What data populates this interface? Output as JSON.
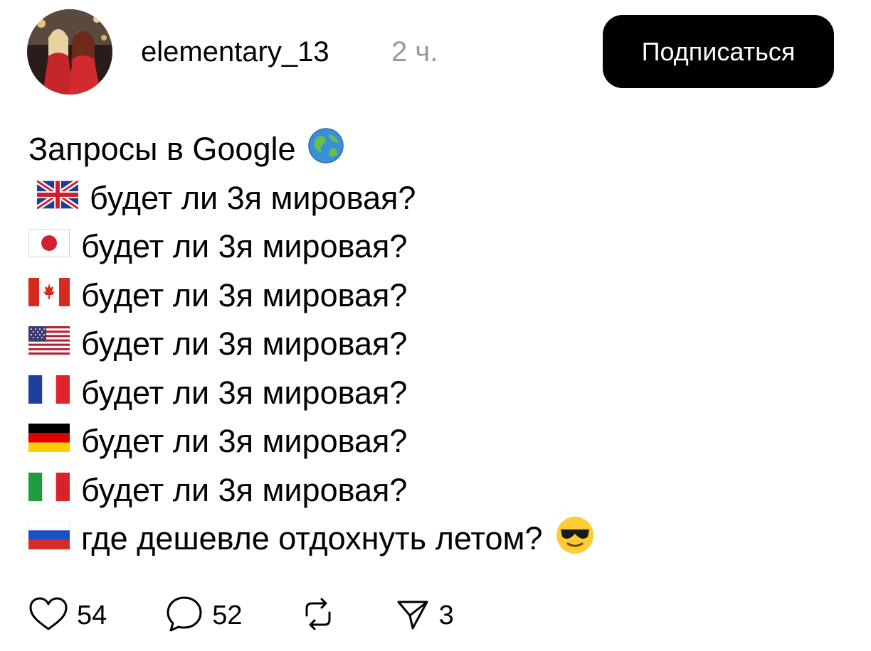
{
  "header": {
    "username": "elementary_13",
    "timestamp": "2 ч.",
    "subscribe_label": "Подписаться"
  },
  "post": {
    "title": "Запросы в Google",
    "lines": [
      {
        "flag": "uk-flag",
        "text": "будет ли 3я мировая?"
      },
      {
        "flag": "japan-flag",
        "text": "будет ли 3я мировая?"
      },
      {
        "flag": "canada-flag",
        "text": "будет ли 3я мировая?"
      },
      {
        "flag": "usa-flag",
        "text": "будет ли 3я мировая?"
      },
      {
        "flag": "france-flag",
        "text": "будет ли 3я мировая?"
      },
      {
        "flag": "germany-flag",
        "text": "будет ли 3я мировая?"
      },
      {
        "flag": "italy-flag",
        "text": "будет ли 3я мировая?"
      },
      {
        "flag": "russia-flag",
        "text": "где дешевле отдохнуть летом?"
      }
    ]
  },
  "actions": {
    "likes": "54",
    "comments": "52",
    "shares": "3"
  },
  "colors": {
    "button_bg": "#000000",
    "button_text": "#ffffff",
    "timestamp": "#999999",
    "text": "#000000"
  }
}
